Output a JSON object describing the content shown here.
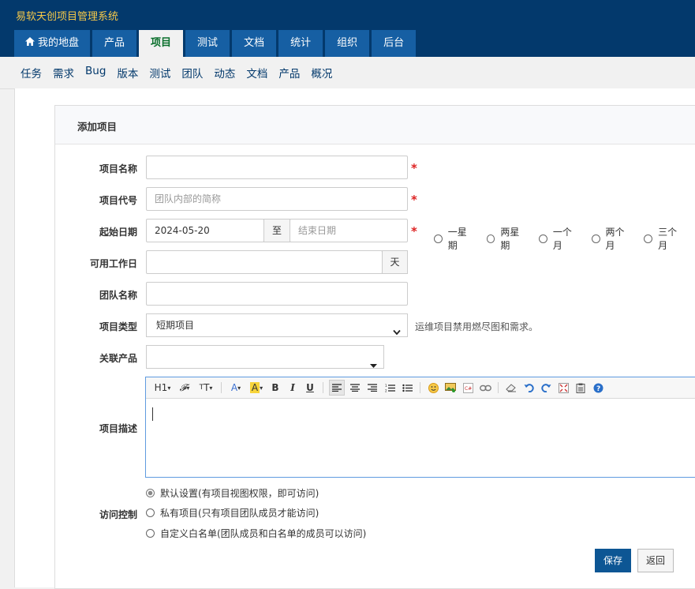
{
  "app": {
    "title": "易软天创项目管理系统"
  },
  "main_nav": [
    {
      "label": "我的地盘",
      "icon": "home-icon"
    },
    {
      "label": "产品"
    },
    {
      "label": "项目",
      "active": true
    },
    {
      "label": "测试"
    },
    {
      "label": "文档"
    },
    {
      "label": "统计"
    },
    {
      "label": "组织"
    },
    {
      "label": "后台"
    }
  ],
  "sub_nav": [
    "任务",
    "需求",
    "Bug",
    "版本",
    "测试",
    "团队",
    "动态",
    "文档",
    "产品",
    "概况"
  ],
  "form": {
    "title": "添加项目",
    "name": {
      "label": "项目名称",
      "value": "",
      "required": "*"
    },
    "code": {
      "label": "项目代号",
      "placeholder": "团队内部的简称",
      "required": "*"
    },
    "dates": {
      "label": "起始日期",
      "begin": "2024-05-20",
      "to": "至",
      "end_placeholder": "结束日期",
      "required": "*",
      "presets": [
        "一星期",
        "两星期",
        "一个月",
        "两个月",
        "三个月"
      ]
    },
    "workdays": {
      "label": "可用工作日",
      "value": "",
      "unit": "天"
    },
    "team": {
      "label": "团队名称",
      "value": ""
    },
    "type": {
      "label": "项目类型",
      "value": "短期项目",
      "hint": "运维项目禁用燃尽图和需求。"
    },
    "products": {
      "label": "关联产品",
      "value": ""
    },
    "description": {
      "label": "项目描述",
      "value": ""
    },
    "access": {
      "label": "访问控制",
      "options": [
        {
          "label": "默认设置(有项目视图权限，即可访问)",
          "checked": true
        },
        {
          "label": "私有项目(只有项目团队成员才能访问)",
          "checked": false
        },
        {
          "label": "自定义白名单(团队成员和白名单的成员可以访问)",
          "checked": false
        }
      ]
    },
    "save_label": "保存",
    "back_label": "返回"
  },
  "editor_toolbar": [
    "heading-icon",
    "font-family-icon",
    "font-size-icon",
    "font-color-icon",
    "background-color-icon",
    "bold-icon",
    "italic-icon",
    "underline-icon",
    "align-left-icon",
    "align-center-icon",
    "align-right-icon",
    "ordered-list-icon",
    "unordered-list-icon",
    "emoticon-icon",
    "image-icon",
    "code-icon",
    "link-icon",
    "eraser-icon",
    "undo-icon",
    "redo-icon",
    "fullscreen-icon",
    "paste-icon",
    "help-icon"
  ],
  "colors": {
    "topbar": "#03396c",
    "tab": "#165fa3",
    "title": "#f7c948",
    "active_tab_text": "#0a6f2c",
    "primary": "#0d5694",
    "required": "#dd2222"
  }
}
